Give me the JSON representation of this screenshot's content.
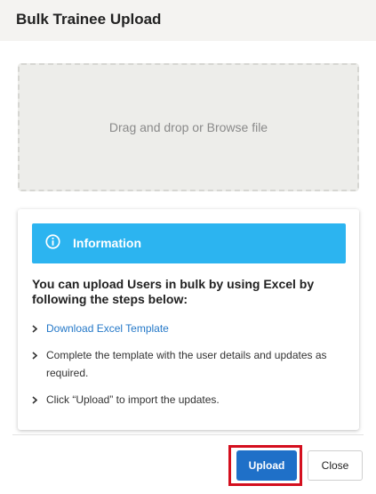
{
  "dialog": {
    "title": "Bulk Trainee Upload"
  },
  "dropzone": {
    "text": "Drag and drop or Browse file"
  },
  "info_card": {
    "banner_title": "Information",
    "banner_icon": "info-icon",
    "banner_color": "#2cb4f0",
    "intro": "You can upload Users in bulk by using Excel by following the steps below:",
    "steps": [
      {
        "text": "Download Excel Template",
        "is_link": true
      },
      {
        "text": "Complete the template with the user details and updates as required.",
        "is_link": false
      },
      {
        "text": "Click “Upload” to import the updates.",
        "is_link": false
      }
    ]
  },
  "footer": {
    "upload_label": "Upload",
    "close_label": "Close",
    "upload_color": "#1f70c8",
    "highlight_color": "#d40f1e"
  }
}
